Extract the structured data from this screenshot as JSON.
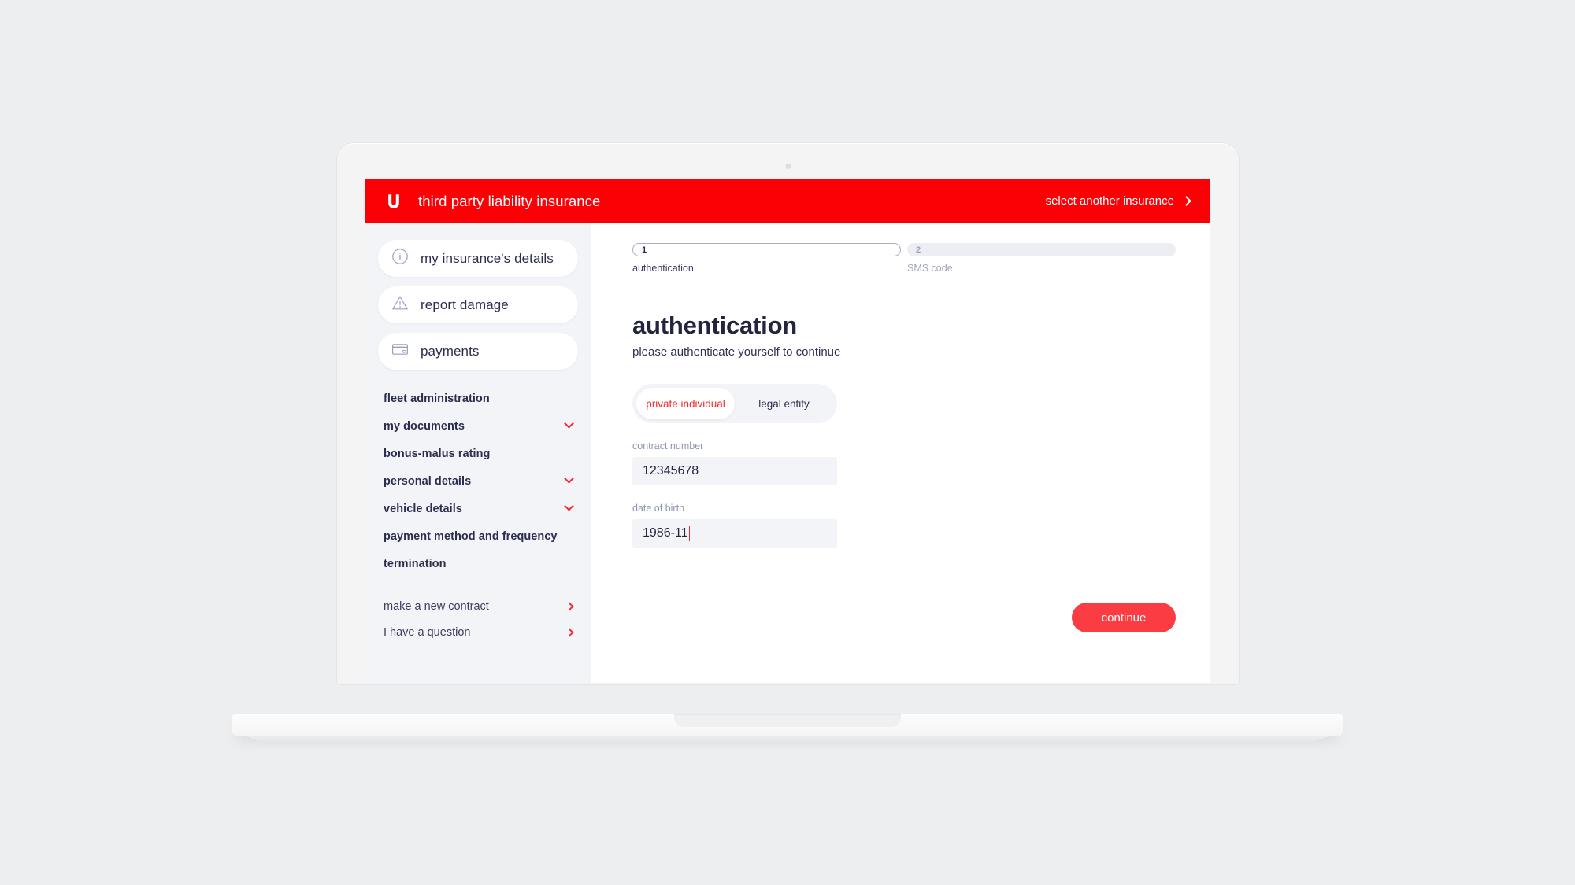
{
  "header": {
    "logo": "U",
    "logo_icon": "u-brand-logo",
    "title": "third party liability insurance",
    "link_label": "select another insurance",
    "link_icon": "chevron-right-icon",
    "bg_color": "#fb0105"
  },
  "sidebar": {
    "cards": [
      {
        "label": "my insurance's details",
        "icon": "info-circle-icon"
      },
      {
        "label": "report damage",
        "icon": "warning-triangle-icon"
      },
      {
        "label": "payments",
        "icon": "credit-card-icon"
      }
    ],
    "nav_primary": [
      {
        "label": "fleet administration",
        "expandable": false
      },
      {
        "label": "my documents",
        "expandable": true,
        "icon": "chevron-down-icon"
      },
      {
        "label": "bonus-malus rating",
        "expandable": false
      },
      {
        "label": "personal details",
        "expandable": true,
        "icon": "chevron-down-icon"
      },
      {
        "label": "vehicle details",
        "expandable": true,
        "icon": "chevron-down-icon"
      },
      {
        "label": "payment method and frequency",
        "expandable": false
      },
      {
        "label": "termination",
        "expandable": false
      }
    ],
    "nav_secondary": [
      {
        "label": "make a new contract",
        "icon": "chevron-right-icon"
      },
      {
        "label": "I have a question",
        "icon": "chevron-right-icon"
      }
    ]
  },
  "stepper": {
    "steps": [
      {
        "number": "1",
        "label": "authentication",
        "state": "active"
      },
      {
        "number": "2",
        "label": "SMS code",
        "state": "inactive"
      }
    ]
  },
  "main": {
    "title": "authentication",
    "subtitle": "please authenticate yourself to continue",
    "segmented": {
      "options": [
        {
          "label": "private individual",
          "selected": true
        },
        {
          "label": "legal entity",
          "selected": false
        }
      ]
    },
    "fields": [
      {
        "label": "contract number",
        "value": "12345678",
        "placeholder": ""
      },
      {
        "label": "date of birth",
        "value": "1986-11",
        "placeholder": "",
        "focused": true
      }
    ],
    "continue_label": "continue"
  },
  "colors": {
    "brand_red": "#fb0105",
    "accent_red": "#f5282d",
    "button_red": "#fb3c42",
    "navy": "#2b2d4e",
    "muted": "#9096b0",
    "surface": "#f3f4f8"
  }
}
